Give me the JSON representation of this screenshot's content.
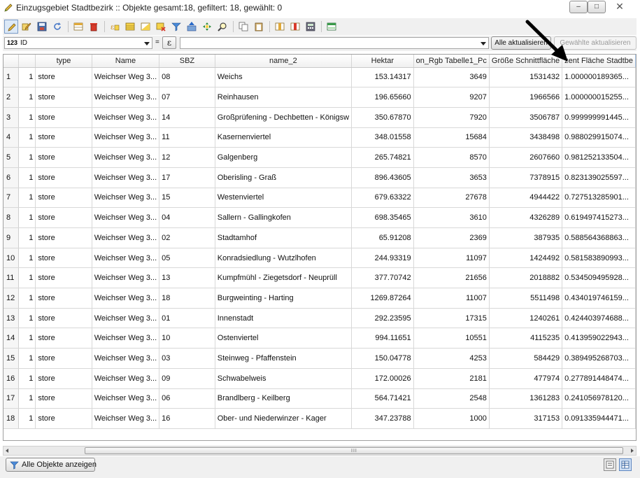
{
  "window": {
    "title": "Einzugsgebiet Stadtbezirk :: Objekte gesamt:18, gefiltert: 18, gewählt: 0",
    "minimize_glyph": "–",
    "maximize_glyph": "□",
    "close_glyph": "✕"
  },
  "toolbar": {
    "icons": [
      "toggle-editing-icon",
      "multi-edit-icon",
      "save-edits-icon",
      "reload-icon",
      "add-feature-icon",
      "delete-feature-icon",
      "select-by-expression-icon",
      "select-all-icon",
      "invert-selection-icon",
      "deselect-all-icon",
      "filter-selected-icon",
      "move-selection-to-top-icon",
      "pan-to-selection-icon",
      "zoom-to-selection-icon",
      "copy-rows-icon",
      "paste-features-icon",
      "new-field-icon",
      "delete-field-icon",
      "open-field-calculator-icon",
      "conditional-formatting-icon"
    ]
  },
  "field_calc": {
    "field_type_badge": "123",
    "field": "ID",
    "equals": "=",
    "expression_symbol": "ε",
    "value": "",
    "update_all_label": "Alle aktualisieren",
    "update_selected_label": "Gewählte aktualisieren"
  },
  "table": {
    "headers": [
      "",
      "type",
      "Name",
      "SBZ",
      "name_2",
      "Hektar",
      "on_Rgb Tabelle1_Pc",
      "Größe Schnittfläche",
      "zent Fläche Stadtbe"
    ],
    "rows": [
      {
        "n": "1",
        "id": "1",
        "type": "store",
        "name": "Weichser Weg 3...",
        "sbz": "08",
        "name_2": "Weichs",
        "hektar": "153.14317",
        "pc": "3649",
        "size": "1531432",
        "pct": "1.000000189365..."
      },
      {
        "n": "2",
        "id": "1",
        "type": "store",
        "name": "Weichser Weg 3...",
        "sbz": "07",
        "name_2": "Reinhausen",
        "hektar": "196.65660",
        "pc": "9207",
        "size": "1966566",
        "pct": "1.000000015255..."
      },
      {
        "n": "3",
        "id": "1",
        "type": "store",
        "name": "Weichser Weg 3...",
        "sbz": "14",
        "name_2": "Großprüfening - Dechbetten - Königsw",
        "hektar": "350.67870",
        "pc": "7920",
        "size": "3506787",
        "pct": "0.999999991445..."
      },
      {
        "n": "4",
        "id": "1",
        "type": "store",
        "name": "Weichser Weg 3...",
        "sbz": "11",
        "name_2": "Kasernenviertel",
        "hektar": "348.01558",
        "pc": "15684",
        "size": "3438498",
        "pct": "0.988029915074..."
      },
      {
        "n": "5",
        "id": "1",
        "type": "store",
        "name": "Weichser Weg 3...",
        "sbz": "12",
        "name_2": "Galgenberg",
        "hektar": "265.74821",
        "pc": "8570",
        "size": "2607660",
        "pct": "0.981252133504..."
      },
      {
        "n": "6",
        "id": "1",
        "type": "store",
        "name": "Weichser Weg 3...",
        "sbz": "17",
        "name_2": "Oberisling - Graß",
        "hektar": "896.43605",
        "pc": "3653",
        "size": "7378915",
        "pct": "0.823139025597..."
      },
      {
        "n": "7",
        "id": "1",
        "type": "store",
        "name": "Weichser Weg 3...",
        "sbz": "15",
        "name_2": "Westenviertel",
        "hektar": "679.63322",
        "pc": "27678",
        "size": "4944422",
        "pct": "0.727513285901..."
      },
      {
        "n": "8",
        "id": "1",
        "type": "store",
        "name": "Weichser Weg 3...",
        "sbz": "04",
        "name_2": "Sallern - Gallingkofen",
        "hektar": "698.35465",
        "pc": "3610",
        "size": "4326289",
        "pct": "0.619497415273..."
      },
      {
        "n": "9",
        "id": "1",
        "type": "store",
        "name": "Weichser Weg 3...",
        "sbz": "02",
        "name_2": "Stadtamhof",
        "hektar": "65.91208",
        "pc": "2369",
        "size": "387935",
        "pct": "0.588564368863..."
      },
      {
        "n": "10",
        "id": "1",
        "type": "store",
        "name": "Weichser Weg 3...",
        "sbz": "05",
        "name_2": "Konradsiedlung - Wutzlhofen",
        "hektar": "244.93319",
        "pc": "11097",
        "size": "1424492",
        "pct": "0.581583890993..."
      },
      {
        "n": "11",
        "id": "1",
        "type": "store",
        "name": "Weichser Weg 3...",
        "sbz": "13",
        "name_2": "Kumpfmühl - Ziegetsdorf - Neuprüll",
        "hektar": "377.70742",
        "pc": "21656",
        "size": "2018882",
        "pct": "0.534509495928..."
      },
      {
        "n": "12",
        "id": "1",
        "type": "store",
        "name": "Weichser Weg 3...",
        "sbz": "18",
        "name_2": "Burgweinting - Harting",
        "hektar": "1269.87264",
        "pc": "11007",
        "size": "5511498",
        "pct": "0.434019746159..."
      },
      {
        "n": "13",
        "id": "1",
        "type": "store",
        "name": "Weichser Weg 3...",
        "sbz": "01",
        "name_2": "Innenstadt",
        "hektar": "292.23595",
        "pc": "17315",
        "size": "1240261",
        "pct": "0.424403974688..."
      },
      {
        "n": "14",
        "id": "1",
        "type": "store",
        "name": "Weichser Weg 3...",
        "sbz": "10",
        "name_2": "Ostenviertel",
        "hektar": "994.11651",
        "pc": "10551",
        "size": "4115235",
        "pct": "0.413959022943..."
      },
      {
        "n": "15",
        "id": "1",
        "type": "store",
        "name": "Weichser Weg 3...",
        "sbz": "03",
        "name_2": "Steinweg - Pfaffenstein",
        "hektar": "150.04778",
        "pc": "4253",
        "size": "584429",
        "pct": "0.389495268703..."
      },
      {
        "n": "16",
        "id": "1",
        "type": "store",
        "name": "Weichser Weg 3...",
        "sbz": "09",
        "name_2": "Schwabelweis",
        "hektar": "172.00026",
        "pc": "2181",
        "size": "477974",
        "pct": "0.277891448474..."
      },
      {
        "n": "17",
        "id": "1",
        "type": "store",
        "name": "Weichser Weg 3...",
        "sbz": "06",
        "name_2": "Brandlberg - Keilberg",
        "hektar": "564.71421",
        "pc": "2548",
        "size": "1361283",
        "pct": "0.241056978120..."
      },
      {
        "n": "18",
        "id": "1",
        "type": "store",
        "name": "Weichser Weg 3...",
        "sbz": "16",
        "name_2": "Ober- und Niederwinzer - Kager",
        "hektar": "347.23788",
        "pc": "1000",
        "size": "317153",
        "pct": "0.091335944471..."
      }
    ]
  },
  "scrollbar": {
    "grip": "III"
  },
  "bottom": {
    "show_all_label": "Alle Objekte anzeigen",
    "views": [
      "form-view-icon",
      "table-view-icon"
    ]
  },
  "colors": {
    "selection_accent": "#dce9f7",
    "annotation_arrow": "#000000"
  }
}
